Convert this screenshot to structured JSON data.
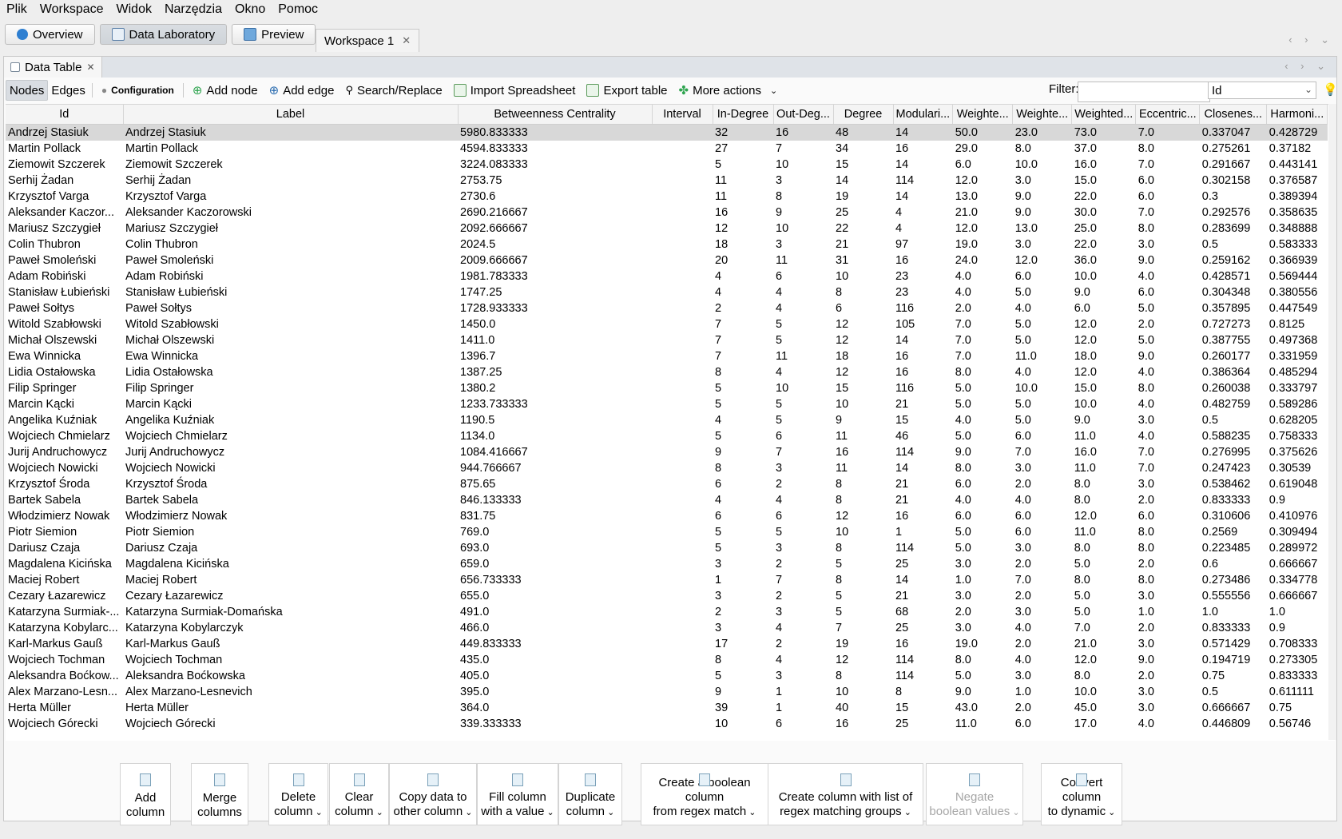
{
  "menu": [
    "Plik",
    "Workspace",
    "Widok",
    "Narzędzia",
    "Okno",
    "Pomoc"
  ],
  "main_buttons": {
    "overview": "Overview",
    "data_lab": "Data Laboratory",
    "preview": "Preview"
  },
  "workspace_tab": "Workspace 1",
  "panel_tab": "Data Table",
  "toolbar": {
    "nodes": "Nodes",
    "edges": "Edges",
    "configuration": "Configuration",
    "add_node": "Add node",
    "add_edge": "Add edge",
    "search_replace": "Search/Replace",
    "import": "Import Spreadsheet",
    "export": "Export table",
    "more": "More actions"
  },
  "filter": {
    "label": "Filter:",
    "value": "",
    "column": "Id"
  },
  "table": {
    "columns": [
      "Id",
      "Label",
      "Betweenness Centrality",
      "Interval",
      "In-Degree",
      "Out-Deg...",
      "Degree",
      "Modulari...",
      "Weighte...",
      "Weighte...",
      "Weighted...",
      "Eccentric...",
      "Closenes...",
      "Harmoni..."
    ],
    "rows": [
      [
        "Andrzej Stasiuk",
        "Andrzej Stasiuk",
        "5980.833333",
        "",
        "32",
        "16",
        "48",
        "14",
        "50.0",
        "23.0",
        "73.0",
        "7.0",
        "0.337047",
        "0.428729"
      ],
      [
        "Martin Pollack",
        "Martin Pollack",
        "4594.833333",
        "",
        "27",
        "7",
        "34",
        "16",
        "29.0",
        "8.0",
        "37.0",
        "8.0",
        "0.275261",
        "0.37182"
      ],
      [
        "Ziemowit Szczerek",
        "Ziemowit Szczerek",
        "3224.083333",
        "",
        "5",
        "10",
        "15",
        "14",
        "6.0",
        "10.0",
        "16.0",
        "7.0",
        "0.291667",
        "0.443141"
      ],
      [
        "Serhij Żadan",
        "Serhij Żadan",
        "2753.75",
        "",
        "11",
        "3",
        "14",
        "114",
        "12.0",
        "3.0",
        "15.0",
        "6.0",
        "0.302158",
        "0.376587"
      ],
      [
        "Krzysztof Varga",
        "Krzysztof Varga",
        "2730.6",
        "",
        "11",
        "8",
        "19",
        "14",
        "13.0",
        "9.0",
        "22.0",
        "6.0",
        "0.3",
        "0.389394"
      ],
      [
        "Aleksander Kaczor...",
        "Aleksander Kaczorowski",
        "2690.216667",
        "",
        "16",
        "9",
        "25",
        "4",
        "21.0",
        "9.0",
        "30.0",
        "7.0",
        "0.292576",
        "0.358635"
      ],
      [
        "Mariusz Szczygieł",
        "Mariusz Szczygieł",
        "2092.666667",
        "",
        "12",
        "10",
        "22",
        "4",
        "12.0",
        "13.0",
        "25.0",
        "8.0",
        "0.283699",
        "0.348888"
      ],
      [
        "Colin Thubron",
        "Colin Thubron",
        "2024.5",
        "",
        "18",
        "3",
        "21",
        "97",
        "19.0",
        "3.0",
        "22.0",
        "3.0",
        "0.5",
        "0.583333"
      ],
      [
        "Paweł Smoleński",
        "Paweł Smoleński",
        "2009.666667",
        "",
        "20",
        "11",
        "31",
        "16",
        "24.0",
        "12.0",
        "36.0",
        "9.0",
        "0.259162",
        "0.366939"
      ],
      [
        "Adam Robiński",
        "Adam Robiński",
        "1981.783333",
        "",
        "4",
        "6",
        "10",
        "23",
        "4.0",
        "6.0",
        "10.0",
        "4.0",
        "0.428571",
        "0.569444"
      ],
      [
        "Stanisław Łubieński",
        "Stanisław Łubieński",
        "1747.25",
        "",
        "4",
        "4",
        "8",
        "23",
        "4.0",
        "5.0",
        "9.0",
        "6.0",
        "0.304348",
        "0.380556"
      ],
      [
        "Paweł Sołtys",
        "Paweł Sołtys",
        "1728.933333",
        "",
        "2",
        "4",
        "6",
        "116",
        "2.0",
        "4.0",
        "6.0",
        "5.0",
        "0.357895",
        "0.447549"
      ],
      [
        "Witold Szabłowski",
        "Witold Szabłowski",
        "1450.0",
        "",
        "7",
        "5",
        "12",
        "105",
        "7.0",
        "5.0",
        "12.0",
        "2.0",
        "0.727273",
        "0.8125"
      ],
      [
        "Michał Olszewski",
        "Michał Olszewski",
        "1411.0",
        "",
        "7",
        "5",
        "12",
        "14",
        "7.0",
        "5.0",
        "12.0",
        "5.0",
        "0.387755",
        "0.497368"
      ],
      [
        "Ewa Winnicka",
        "Ewa Winnicka",
        "1396.7",
        "",
        "7",
        "11",
        "18",
        "16",
        "7.0",
        "11.0",
        "18.0",
        "9.0",
        "0.260177",
        "0.331959"
      ],
      [
        "Lidia Ostałowska",
        "Lidia Ostałowska",
        "1387.25",
        "",
        "8",
        "4",
        "12",
        "16",
        "8.0",
        "4.0",
        "12.0",
        "4.0",
        "0.386364",
        "0.485294"
      ],
      [
        "Filip Springer",
        "Filip Springer",
        "1380.2",
        "",
        "5",
        "10",
        "15",
        "116",
        "5.0",
        "10.0",
        "15.0",
        "8.0",
        "0.260038",
        "0.333797"
      ],
      [
        "Marcin Kącki",
        "Marcin Kącki",
        "1233.733333",
        "",
        "5",
        "5",
        "10",
        "21",
        "5.0",
        "5.0",
        "10.0",
        "4.0",
        "0.482759",
        "0.589286"
      ],
      [
        "Angelika Kuźniak",
        "Angelika Kuźniak",
        "1190.5",
        "",
        "4",
        "5",
        "9",
        "15",
        "4.0",
        "5.0",
        "9.0",
        "3.0",
        "0.5",
        "0.628205"
      ],
      [
        "Wojciech Chmielarz",
        "Wojciech Chmielarz",
        "1134.0",
        "",
        "5",
        "6",
        "11",
        "46",
        "5.0",
        "6.0",
        "11.0",
        "4.0",
        "0.588235",
        "0.758333"
      ],
      [
        "Jurij Andruchowycz",
        "Jurij Andruchowycz",
        "1084.416667",
        "",
        "9",
        "7",
        "16",
        "114",
        "9.0",
        "7.0",
        "16.0",
        "7.0",
        "0.276995",
        "0.375626"
      ],
      [
        "Wojciech Nowicki",
        "Wojciech Nowicki",
        "944.766667",
        "",
        "8",
        "3",
        "11",
        "14",
        "8.0",
        "3.0",
        "11.0",
        "7.0",
        "0.247423",
        "0.30539"
      ],
      [
        "Krzysztof Środa",
        "Krzysztof Środa",
        "875.65",
        "",
        "6",
        "2",
        "8",
        "21",
        "6.0",
        "2.0",
        "8.0",
        "3.0",
        "0.538462",
        "0.619048"
      ],
      [
        "Bartek Sabela",
        "Bartek Sabela",
        "846.133333",
        "",
        "4",
        "4",
        "8",
        "21",
        "4.0",
        "4.0",
        "8.0",
        "2.0",
        "0.833333",
        "0.9"
      ],
      [
        "Włodzimierz Nowak",
        "Włodzimierz Nowak",
        "831.75",
        "",
        "6",
        "6",
        "12",
        "16",
        "6.0",
        "6.0",
        "12.0",
        "6.0",
        "0.310606",
        "0.410976"
      ],
      [
        "Piotr Siemion",
        "Piotr Siemion",
        "769.0",
        "",
        "5",
        "5",
        "10",
        "1",
        "5.0",
        "6.0",
        "11.0",
        "8.0",
        "0.2569",
        "0.309494"
      ],
      [
        "Dariusz Czaja",
        "Dariusz Czaja",
        "693.0",
        "",
        "5",
        "3",
        "8",
        "114",
        "5.0",
        "3.0",
        "8.0",
        "8.0",
        "0.223485",
        "0.289972"
      ],
      [
        "Magdalena Kicińska",
        "Magdalena Kicińska",
        "659.0",
        "",
        "3",
        "2",
        "5",
        "25",
        "3.0",
        "2.0",
        "5.0",
        "2.0",
        "0.6",
        "0.666667"
      ],
      [
        "Maciej Robert",
        "Maciej Robert",
        "656.733333",
        "",
        "1",
        "7",
        "8",
        "14",
        "1.0",
        "7.0",
        "8.0",
        "8.0",
        "0.273486",
        "0.334778"
      ],
      [
        "Cezary Łazarewicz",
        "Cezary Łazarewicz",
        "655.0",
        "",
        "3",
        "2",
        "5",
        "21",
        "3.0",
        "2.0",
        "5.0",
        "3.0",
        "0.555556",
        "0.666667"
      ],
      [
        "Katarzyna Surmiak-...",
        "Katarzyna Surmiak-Domańska",
        "491.0",
        "",
        "2",
        "3",
        "5",
        "68",
        "2.0",
        "3.0",
        "5.0",
        "1.0",
        "1.0",
        "1.0"
      ],
      [
        "Katarzyna Kobylarc...",
        "Katarzyna Kobylarczyk",
        "466.0",
        "",
        "3",
        "4",
        "7",
        "25",
        "3.0",
        "4.0",
        "7.0",
        "2.0",
        "0.833333",
        "0.9"
      ],
      [
        "Karl-Markus Gauß",
        "Karl-Markus Gauß",
        "449.833333",
        "",
        "17",
        "2",
        "19",
        "16",
        "19.0",
        "2.0",
        "21.0",
        "3.0",
        "0.571429",
        "0.708333"
      ],
      [
        "Wojciech Tochman",
        "Wojciech Tochman",
        "435.0",
        "",
        "8",
        "4",
        "12",
        "114",
        "8.0",
        "4.0",
        "12.0",
        "9.0",
        "0.194719",
        "0.273305"
      ],
      [
        "Aleksandra Boćkow...",
        "Aleksandra Boćkowska",
        "405.0",
        "",
        "5",
        "3",
        "8",
        "114",
        "5.0",
        "3.0",
        "8.0",
        "2.0",
        "0.75",
        "0.833333"
      ],
      [
        "Alex Marzano-Lesn...",
        "Alex Marzano-Lesnevich",
        "395.0",
        "",
        "9",
        "1",
        "10",
        "8",
        "9.0",
        "1.0",
        "10.0",
        "3.0",
        "0.5",
        "0.611111"
      ],
      [
        "Herta Müller",
        "Herta Müller",
        "364.0",
        "",
        "39",
        "1",
        "40",
        "15",
        "43.0",
        "2.0",
        "45.0",
        "3.0",
        "0.666667",
        "0.75"
      ],
      [
        "Wojciech Górecki",
        "Wojciech Górecki",
        "339.333333",
        "",
        "10",
        "6",
        "16",
        "25",
        "11.0",
        "6.0",
        "17.0",
        "4.0",
        "0.446809",
        "0.56746"
      ]
    ]
  },
  "actions": [
    {
      "line1": "Add",
      "line2": "column",
      "dropdown": false,
      "disabled": false
    },
    {
      "line1": "Merge",
      "line2": "columns",
      "dropdown": false,
      "disabled": false
    },
    {
      "line1": "Delete",
      "line2": "column",
      "dropdown": true,
      "disabled": false
    },
    {
      "line1": "Clear",
      "line2": "column",
      "dropdown": true,
      "disabled": false
    },
    {
      "line1": "Copy data to",
      "line2": "other column",
      "dropdown": true,
      "disabled": false
    },
    {
      "line1": "Fill column",
      "line2": "with a value",
      "dropdown": true,
      "disabled": false
    },
    {
      "line1": "Duplicate",
      "line2": "column",
      "dropdown": true,
      "disabled": false
    },
    {
      "line1": "Create a boolean column",
      "line2": "from regex match",
      "dropdown": true,
      "disabled": false
    },
    {
      "line1": "Create column with list of",
      "line2": "regex matching groups",
      "dropdown": true,
      "disabled": false
    },
    {
      "line1": "Negate",
      "line2": "boolean values",
      "dropdown": true,
      "disabled": true
    },
    {
      "line1": "Convert column",
      "line2": "to dynamic",
      "dropdown": true,
      "disabled": false
    }
  ]
}
